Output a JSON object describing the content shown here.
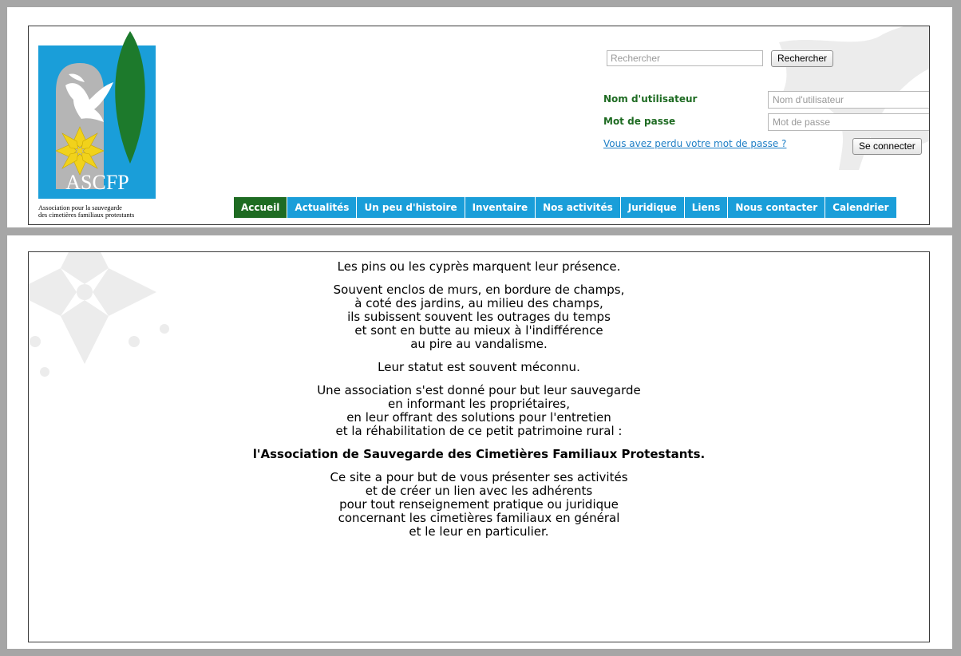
{
  "logo": {
    "acronym": "ASCFP",
    "subtitle_line1": "Association pour la sauvegarde",
    "subtitle_line2": "des cimetières familiaux protestants"
  },
  "search": {
    "placeholder": "Rechercher",
    "button_label": "Rechercher"
  },
  "login": {
    "username_label": "Nom d'utilisateur",
    "username_placeholder": "Nom d'utilisateur",
    "password_label": "Mot de passe",
    "password_placeholder": "Mot de passe",
    "forgot_link": "Vous avez perdu votre mot de passe ?",
    "submit_label": "Se connecter"
  },
  "nav": {
    "items": [
      {
        "label": "Accueil",
        "active": true
      },
      {
        "label": "Actualités"
      },
      {
        "label": "Un peu d'histoire"
      },
      {
        "label": "Inventaire"
      },
      {
        "label": "Nos activités"
      },
      {
        "label": "Juridique"
      },
      {
        "label": "Liens"
      },
      {
        "label": "Nous contacter"
      },
      {
        "label": "Calendrier"
      }
    ]
  },
  "content": {
    "paragraphs": [
      "Les pins ou les cyprès marquent leur présence.",
      "Souvent enclos de murs, en bordure de champs,\nà coté des jardins, au milieu des champs,\nils subissent souvent les outrages du temps\net sont en butte au mieux à l'indifférence\nau pire au vandalisme.",
      "Leur statut est souvent méconnu.",
      "Une association s'est donné pour but leur sauvegarde\nen informant les propriétaires,\nen leur offrant des solutions pour l'entretien\net la réhabilitation de ce petit patrimoine rural :",
      "l'Association de Sauvegarde des Cimetières Familiaux Protestants.",
      "Ce site a pour but de vous présenter ses activités\net de créer un lien avec les adhérents\npour tout renseignement pratique ou juridique\nconcernant les cimetières familiaux en général\net le leur en particulier."
    ]
  },
  "colors": {
    "nav_blue": "#1a9ed9",
    "nav_active_green": "#1e6b22",
    "label_green": "#1e6b22",
    "link_blue": "#1f7fc6",
    "frame_gray": "#a6a6a6",
    "logo_blue": "#1a9ed9"
  },
  "icons": {
    "watermark_header": "dove-watermark-icon",
    "watermark_main": "huguenot-cross-watermark-icon"
  }
}
